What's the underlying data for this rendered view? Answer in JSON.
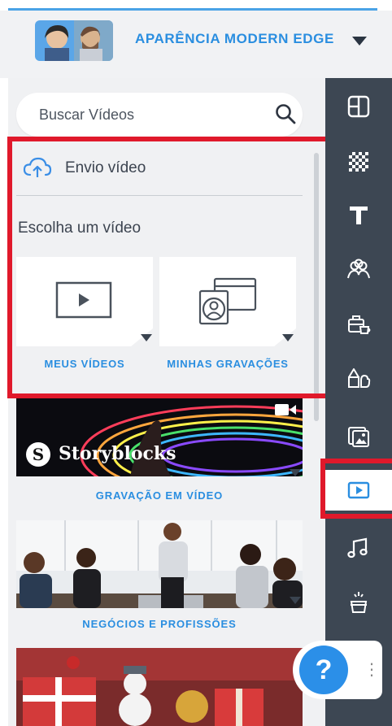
{
  "header": {
    "title": "APARÊNCIA MODERN EDGE",
    "avatar_icon": "couple-avatar-icon",
    "dropdown_icon": "caret-down-icon"
  },
  "search": {
    "placeholder": "Buscar Vídeos",
    "value": "",
    "icon": "search-icon"
  },
  "upload": {
    "label": "Envio vídeo",
    "icon": "cloud-upload-icon"
  },
  "choose": {
    "label": "Escolha um vídeo",
    "cards": [
      {
        "label": "MEUS VÍDEOS",
        "icon": "play-video-icon"
      },
      {
        "label": "MINHAS GRAVAÇÕES",
        "icon": "recording-icon"
      }
    ]
  },
  "categories": [
    {
      "label": "GRAVAÇÃO EM VÍDEO",
      "logo_text": "Storyblocks",
      "logo_glyph": "S",
      "icon": "video-camera-icon"
    },
    {
      "label": "NEGÓCIOS E PROFISSÕES"
    },
    {
      "label": ""
    }
  ],
  "rail": {
    "items": [
      {
        "name": "layout-icon"
      },
      {
        "name": "background-texture-icon"
      },
      {
        "name": "text-icon",
        "glyph": "T"
      },
      {
        "name": "characters-icon"
      },
      {
        "name": "props-icon"
      },
      {
        "name": "shapes-icon"
      },
      {
        "name": "images-icon"
      },
      {
        "name": "video-icon",
        "active": true
      },
      {
        "name": "music-icon",
        "glyph": "♫"
      },
      {
        "name": "magic-icon"
      }
    ]
  },
  "help": {
    "label": "?",
    "more_label": "⋮"
  },
  "colors": {
    "accent": "#2a8ee0",
    "highlight": "#e0192b",
    "rail": "#3d4753",
    "panel": "#f0f1f3"
  }
}
